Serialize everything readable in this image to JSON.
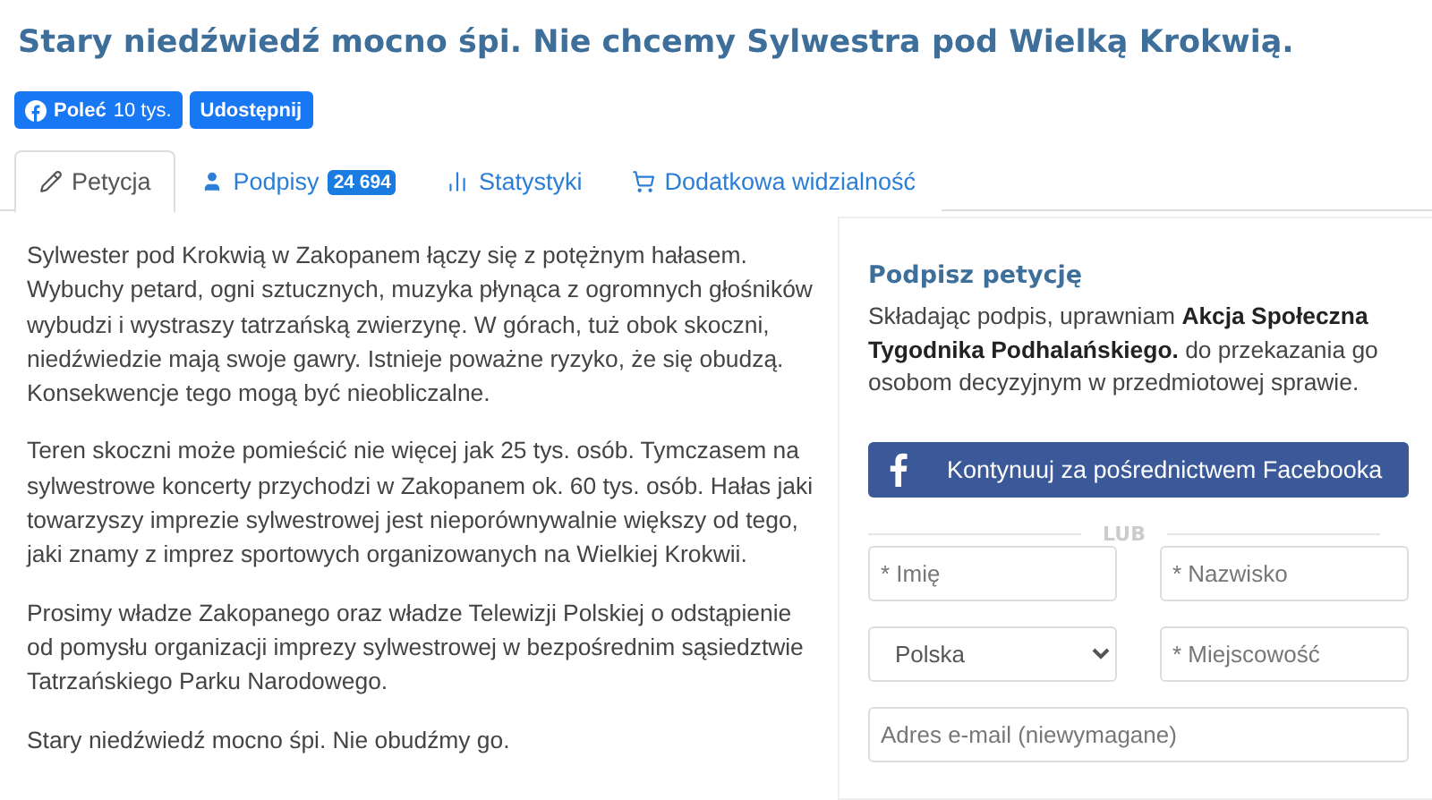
{
  "title": "Stary niedźwiedź mocno śpi. Nie chcemy Sylwestra pod Wielką Krokwią.",
  "social": {
    "like_label": "Poleć",
    "like_count": "10 tys.",
    "share_label": "Udostępnij"
  },
  "tabs": [
    {
      "kind": "pencil",
      "label": "Petycja",
      "selected": true
    },
    {
      "kind": "user",
      "label": "Podpisy",
      "badge": "24 694",
      "selected": false
    },
    {
      "kind": "chart",
      "label": "Statystyki",
      "selected": false
    },
    {
      "kind": "cart",
      "label": "Dodatkowa widzialność",
      "selected": false
    }
  ],
  "paragraphs": [
    "Sylwester pod Krokwią w Zakopanem łączy się z potężnym hałasem. Wybuchy petard, ogni sztucznych, muzyka płynąca z ogromnych głośników wybudzi i wystraszy tatrzańską zwierzynę. W górach, tuż obok skoczni, niedźwiedzie mają swoje gawry. Istnieje poważne ryzyko, że się obudzą. Konsekwencje tego mogą być nieobliczalne.",
    "Teren skoczni może pomieścić nie więcej jak 25 tys. osób. Tymczasem na sylwestrowe koncerty przychodzi  w Zakopanem ok. 60 tys. osób. Hałas jaki towarzyszy imprezie sylwestrowej jest nieporównywalnie większy od tego, jaki znamy z imprez sportowych organizowanych na Wielkiej Krokwii.",
    "Prosimy władze Zakopanego oraz władze Telewizji Polskiej o odstąpienie od pomysłu organizacji imprezy sylwestrowej w bezpośrednim sąsiedztwie Tatrzańskiego Parku Narodowego.",
    "Stary niedźwiedź mocno śpi. Nie obudźmy go."
  ],
  "sign_panel": {
    "heading": "Podpisz petycję",
    "description": "Składając podpis, uprawniam **Akcja Społeczna Tygodnika Podhalańskiego.** do przekazania go osobom decyzyjnym w przedmiotowej sprawie.",
    "facebook_button": "Kontynuuj za pośrednictwem Facebooka",
    "divider": "LUB",
    "first_name": {
      "placeholder": "* Imię"
    },
    "last_name": {
      "placeholder": "* Nazwisko"
    },
    "country": {
      "value": "Polska"
    },
    "city": {
      "placeholder": "* Miejscowość"
    },
    "email": {
      "placeholder": "Adres e-mail (niewymagane)"
    }
  }
}
